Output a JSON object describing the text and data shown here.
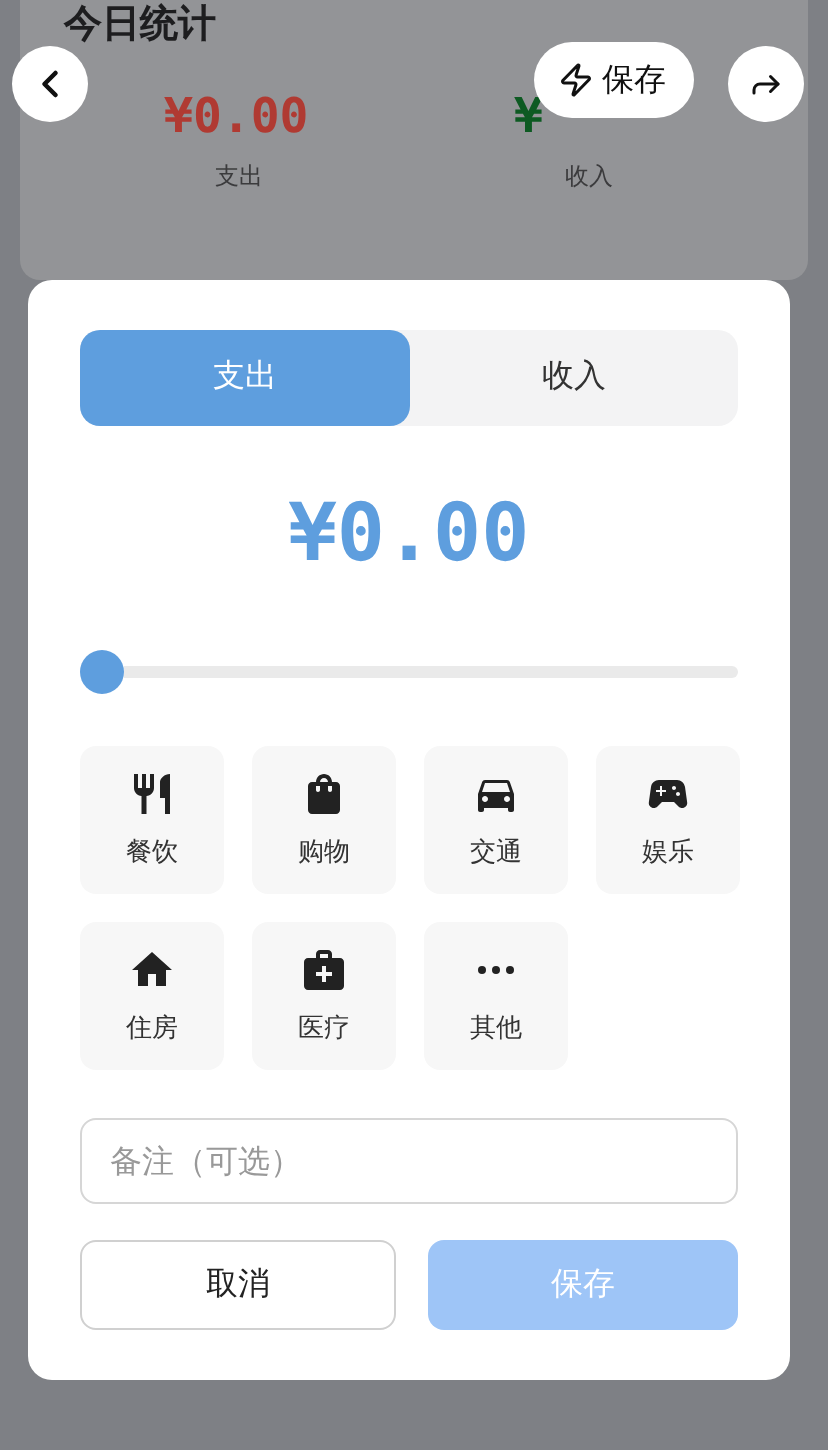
{
  "background_card": {
    "title": "今日统计",
    "stats": [
      {
        "amount": "¥0.00",
        "label": "支出",
        "color": "#b03a32"
      },
      {
        "amount": "¥",
        "label": "收入",
        "color": "#0d5a22"
      }
    ]
  },
  "top_bar": {
    "back": {
      "kind": "back"
    },
    "save": {
      "label": "保存"
    },
    "share": {
      "kind": "share"
    }
  },
  "dialog": {
    "tabs": [
      {
        "label": "支出",
        "selected": true
      },
      {
        "label": "收入",
        "selected": false
      }
    ],
    "amount": "¥0.00",
    "slider": {
      "level": 0
    },
    "categories": [
      {
        "kind": "food",
        "label": "餐饮",
        "selected": false
      },
      {
        "kind": "shopping",
        "label": "购物",
        "selected": false
      },
      {
        "kind": "transport",
        "label": "交通",
        "selected": false
      },
      {
        "kind": "entertainment",
        "label": "娱乐",
        "selected": false
      },
      {
        "kind": "housing",
        "label": "住房",
        "selected": false
      },
      {
        "kind": "medical",
        "label": "医疗",
        "selected": false
      },
      {
        "kind": "other",
        "label": "其他",
        "selected": false
      }
    ],
    "note": {
      "placeholder": "备注（可选）"
    },
    "buttons": [
      {
        "label": "取消",
        "kind": "cancel",
        "disabled": false
      },
      {
        "label": "保存",
        "kind": "save",
        "disabled": true
      }
    ]
  }
}
